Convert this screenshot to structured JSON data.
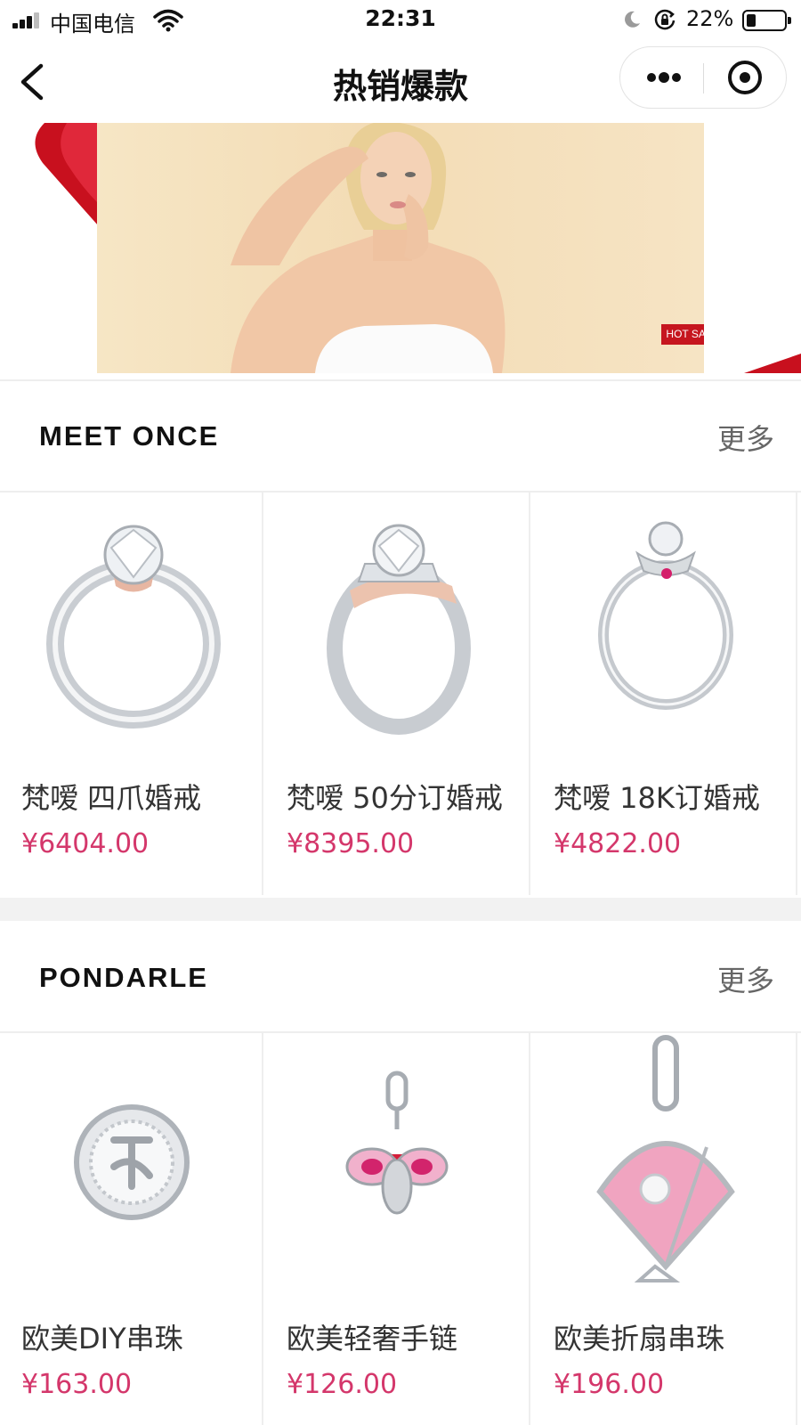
{
  "status_bar": {
    "carrier": "中国电信",
    "time": "22:31",
    "battery_percent": "22%",
    "battery_level": 0.22
  },
  "nav": {
    "title": "热销爆款",
    "back_icon": "chevron-left-icon",
    "more_icon": "more-dots-icon",
    "close_icon": "target-circle-icon"
  },
  "banner": {
    "badge": "HOT SALE",
    "accent_color": "#c6161f"
  },
  "sections": [
    {
      "brand": "MEET ONCE",
      "more_label": "更多",
      "products": [
        {
          "name": "梵嗳 四爪婚戒",
          "price": "¥6404.00",
          "image_icon": "solitaire-ring-icon"
        },
        {
          "name": "梵嗳 50分订婚戒",
          "price": "¥8395.00",
          "image_icon": "pave-ring-icon"
        },
        {
          "name": "梵嗳 18K订婚戒",
          "price": "¥4822.00",
          "image_icon": "ruby-accent-ring-icon"
        }
      ]
    },
    {
      "brand": "PONDARLE",
      "more_label": "更多",
      "products": [
        {
          "name": "欧美DIY串珠",
          "price": "¥163.00",
          "image_icon": "round-charm-bead-icon"
        },
        {
          "name": "欧美轻奢手链",
          "price": "¥126.00",
          "image_icon": "bee-pendant-icon"
        },
        {
          "name": "欧美折扇串珠",
          "price": "¥196.00",
          "image_icon": "fan-pendant-icon"
        }
      ]
    }
  ],
  "colors": {
    "price": "#d4376b",
    "divider": "#eeeeee",
    "band": "#f2f2f2"
  }
}
